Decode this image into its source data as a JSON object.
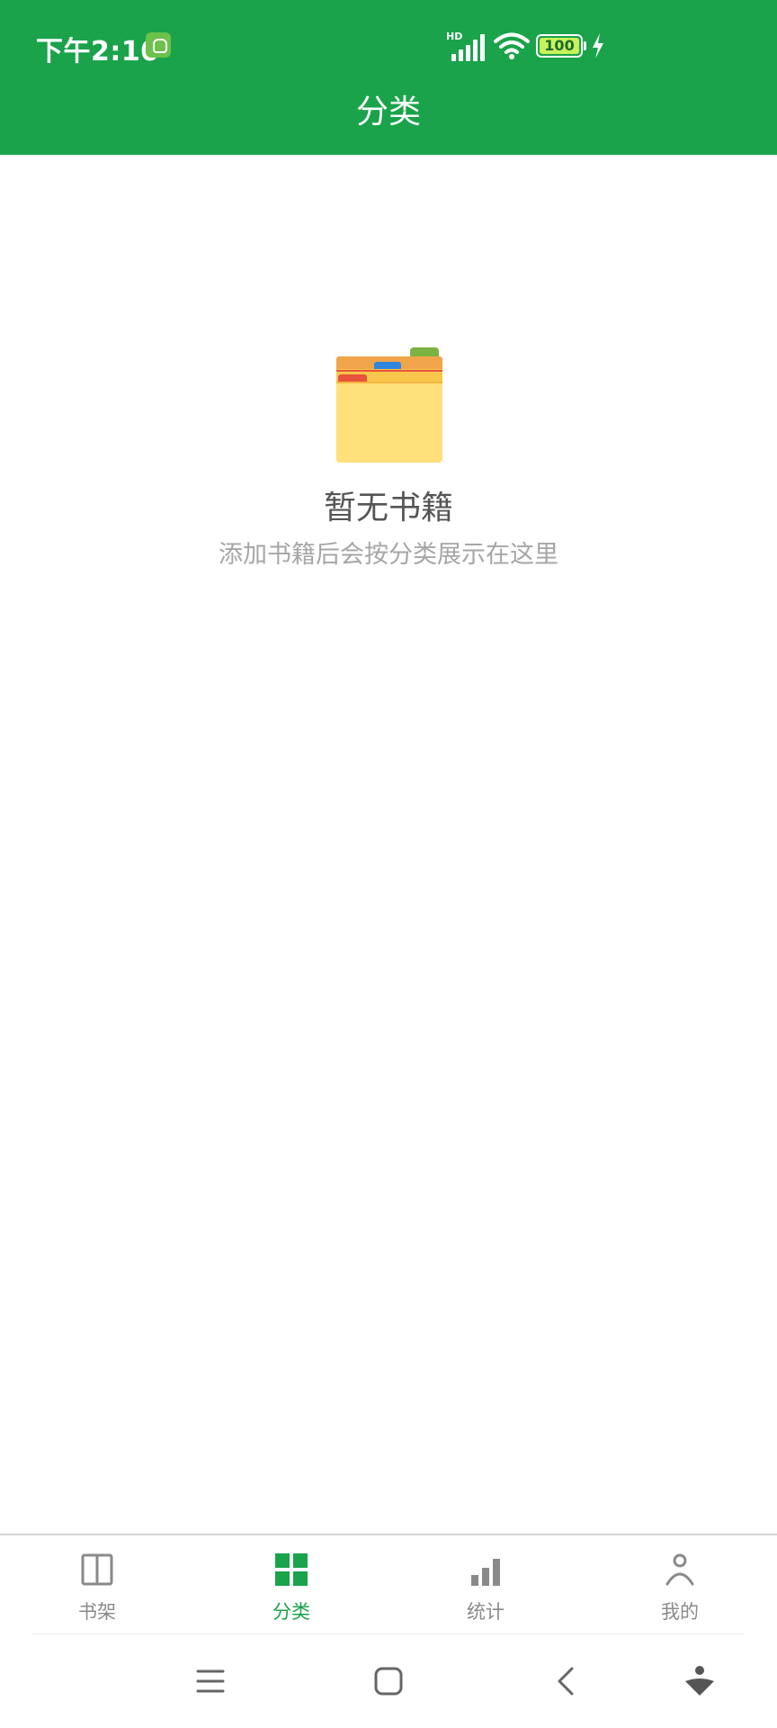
{
  "status_bar": {
    "time": "下午2:10",
    "network_label": "HD",
    "battery_level": "100",
    "battery_percent": 100,
    "icons": [
      "app-notification-icon",
      "signal-icon",
      "wifi-icon",
      "battery-icon",
      "charging-icon"
    ]
  },
  "header": {
    "title": "分类"
  },
  "empty_state": {
    "icon": "folder-icon",
    "title": "暂无书籍",
    "subtitle": "添加书籍后会按分类展示在这里"
  },
  "tab_bar": {
    "items": [
      {
        "label": "书架",
        "icon": "book-icon",
        "active": false
      },
      {
        "label": "分类",
        "icon": "grid-icon",
        "active": true
      },
      {
        "label": "统计",
        "icon": "bar-chart-icon",
        "active": false
      },
      {
        "label": "我的",
        "icon": "user-icon",
        "active": false
      }
    ]
  },
  "system_nav": {
    "buttons": [
      "menu-icon",
      "home-icon",
      "back-icon",
      "assistant-icon"
    ]
  },
  "colors": {
    "primary": "#1aa34a",
    "tab_inactive": "#8a8a8a",
    "empty_title": "#555555",
    "empty_subtitle": "#a6a6a6"
  }
}
